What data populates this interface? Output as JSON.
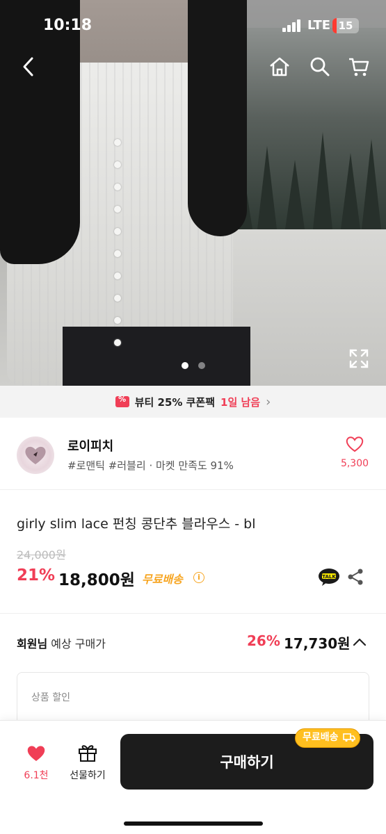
{
  "status_bar": {
    "time": "10:18",
    "network": "LTE",
    "battery": "15",
    "battery_level_percent": 15
  },
  "top_nav": {
    "back_icon": "chevron-left-icon",
    "home_icon": "home-icon",
    "search_icon": "search-icon",
    "cart_icon": "cart-icon"
  },
  "gallery": {
    "total_images": 2,
    "current_index": 1,
    "expand_icon": "expand-icon"
  },
  "coupon_banner": {
    "text": "뷰티 25% 쿠폰팩",
    "highlight": "1일 남음",
    "icon": "coupon-icon",
    "accent_color": "#f03e56"
  },
  "store": {
    "name": "로이피치",
    "tags": "#로맨틱 #러블리 · 마켓 만족도 91%",
    "like_count": "5,300",
    "like_icon": "heart-outline-icon"
  },
  "product": {
    "title": "girly slim lace 펀칭 콩단추 블라우스 - bl",
    "original_price": "24,000원",
    "discount_rate": "21%",
    "sale_price": "18,800원",
    "shipping_label": "무료배송",
    "info_icon": "info-icon",
    "share_kakao_label": "TALK",
    "share_icon": "share-icon"
  },
  "member_price": {
    "label_bold": "회원님",
    "label_rest": " 예상 구매가",
    "discount_rate": "26%",
    "price": "17,730원",
    "toggle_icon": "chevron-up-icon"
  },
  "discount_section": {
    "title": "상품 할인"
  },
  "bottom_bar": {
    "favorite_count": "6.1천",
    "gift_label": "선물하기",
    "buy_label": "구매하기",
    "free_shipping_badge": "무료배송",
    "brand_color": "#1c1c1c",
    "badge_color": "#ffbf1f"
  }
}
